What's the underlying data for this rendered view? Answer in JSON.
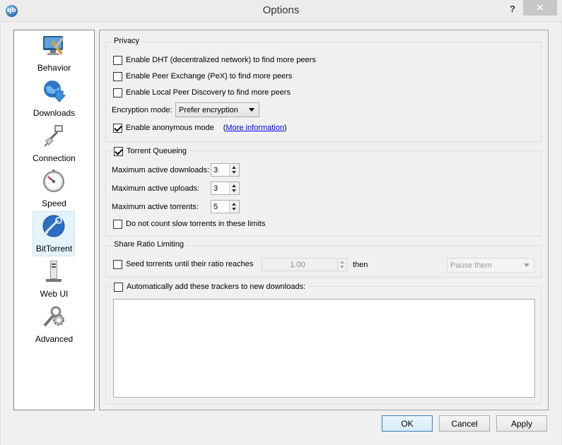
{
  "window": {
    "title": "Options",
    "help_label": "?",
    "close_label": "✕",
    "app_icon_text": "qb"
  },
  "sidebar": {
    "items": [
      {
        "label": "Behavior",
        "icon": "monitor-tools-icon"
      },
      {
        "label": "Downloads",
        "icon": "globe-download-icon"
      },
      {
        "label": "Connection",
        "icon": "network-plug-icon"
      },
      {
        "label": "Speed",
        "icon": "speedometer-icon"
      },
      {
        "label": "BitTorrent",
        "icon": "bittorrent-globe-icon"
      },
      {
        "label": "Web UI",
        "icon": "web-server-icon"
      },
      {
        "label": "Advanced",
        "icon": "wrench-gear-icon"
      }
    ],
    "selected": "BitTorrent"
  },
  "privacy": {
    "title": "Privacy",
    "dht_label": "Enable DHT (decentralized network) to find more peers",
    "dht_checked": false,
    "pex_label": "Enable Peer Exchange (PeX) to find more peers",
    "pex_checked": false,
    "lpd_label": "Enable Local Peer Discovery to find more peers",
    "lpd_checked": false,
    "encryption_label": "Encryption mode:",
    "encryption_value": "Prefer encryption",
    "anonymous_label": "Enable anonymous mode",
    "anonymous_checked": true,
    "more_info_open": "(",
    "more_info_link": "More information",
    "more_info_close": ")"
  },
  "queueing": {
    "title": "Torrent Queueing",
    "enabled": true,
    "max_downloads_label": "Maximum active downloads:",
    "max_downloads_value": "3",
    "max_uploads_label": "Maximum active uploads:",
    "max_uploads_value": "3",
    "max_torrents_label": "Maximum active torrents:",
    "max_torrents_value": "5",
    "slow_label": "Do not count slow torrents in these limits",
    "slow_checked": false
  },
  "share_ratio": {
    "title": "Share Ratio Limiting",
    "seed_label": "Seed torrents until their ratio reaches",
    "seed_checked": false,
    "ratio_value": "1.00",
    "then_label": "then",
    "action_value": "Pause them"
  },
  "trackers": {
    "label": "Automatically add these trackers to new downloads:",
    "checked": false,
    "text": ""
  },
  "buttons": {
    "ok": "OK",
    "cancel": "Cancel",
    "apply": "Apply"
  },
  "colors": {
    "accent": "#3c7fb1",
    "link": "#0000ff",
    "selection": "#e5f3fb"
  }
}
